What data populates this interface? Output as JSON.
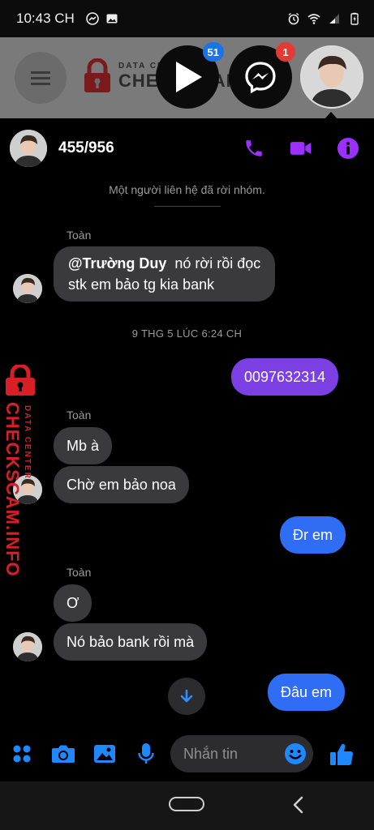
{
  "status_bar": {
    "time": "10:43 CH"
  },
  "background_page": {
    "logo_line1": "DATA CENTER",
    "logo_line2": "CHECKSCAM"
  },
  "chat_heads": {
    "video_badge": "51",
    "messenger_badge": "1"
  },
  "header": {
    "title": "455/956"
  },
  "system_note": "Một người liên hệ đã rời nhóm.",
  "messages": [
    {
      "sender": "Toàn",
      "mention": "@Trường Duy",
      "text_line1": "nó rời rồi đọc",
      "text_line2": "stk em bảo tg kia bank"
    },
    {
      "timestamp": "9 THG 5 LÚC 6:24 CH"
    },
    {
      "text": "0097632314"
    },
    {
      "sender": "Toàn",
      "text": "Mb à"
    },
    {
      "text": "Chờ em bảo noa"
    },
    {
      "text": "Đr em"
    },
    {
      "sender": "Toàn",
      "text": "Ơ"
    },
    {
      "text": "Nó bảo bank rồi mà"
    },
    {
      "text": "Đâu em"
    }
  ],
  "watermark": {
    "line1": "DATA CENTER",
    "line2": "CHECKSCAM.INFO"
  },
  "composer": {
    "placeholder": "Nhắn tin"
  },
  "colors": {
    "accent_purple": "#9b30ff",
    "bubble_purple": "#7b3fe4",
    "bubble_blue": "#2f6df5",
    "incoming_bubble": "#3a3a3c",
    "composer_icon_blue": "#1e88ff",
    "watermark_red": "#d81f26"
  },
  "icons": [
    "phone-icon",
    "video-call-icon",
    "info-icon",
    "apps-icon",
    "camera-icon",
    "gallery-icon",
    "mic-icon",
    "emoji-icon",
    "thumbs-up-icon",
    "arrow-down-icon"
  ]
}
